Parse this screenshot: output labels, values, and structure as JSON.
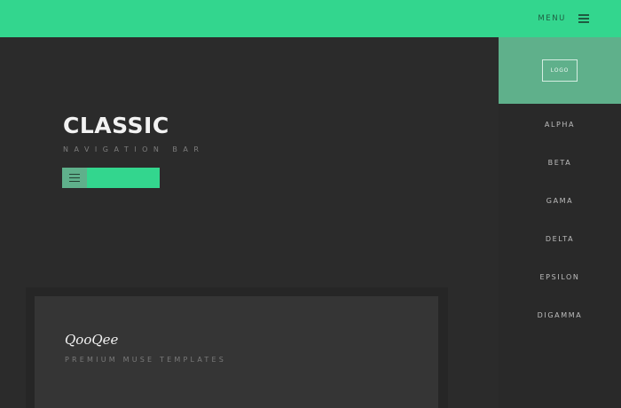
{
  "topbar": {
    "menu_label": "MENU",
    "menu_icon": "hamburger-icon",
    "background": "#33d68e"
  },
  "sidebar": {
    "logo_label": "LOGO",
    "logo_background": "#5fb08b",
    "items": [
      {
        "label": "ALPHA"
      },
      {
        "label": "BETA"
      },
      {
        "label": "GAMA"
      },
      {
        "label": "DELTA"
      },
      {
        "label": "EPSILON"
      },
      {
        "label": "DIGAMMA"
      }
    ]
  },
  "hero": {
    "title": "CLASSIC",
    "subtitle": "NAVIGATION BAR",
    "toggle_icon": "hamburger-icon"
  },
  "card": {
    "brand": "QooQee",
    "tagline": "PREMIUM MUSE TEMPLATES"
  },
  "colors": {
    "accent": "#33d68e",
    "accent_muted": "#5fb08b",
    "background": "#2b2b2b",
    "sidebar": "#292929",
    "card": "#353535"
  }
}
